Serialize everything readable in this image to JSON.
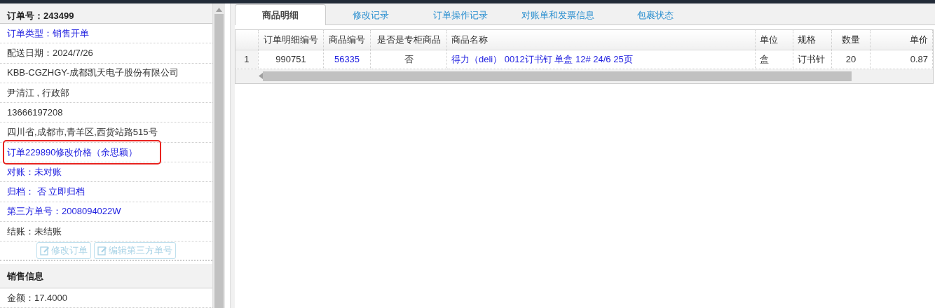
{
  "order_panel": {
    "title": "订单号：243499",
    "rows": [
      {
        "text": "订单类型：销售开单",
        "kind": "link",
        "highlighted": false
      },
      {
        "text": "配送日期：2024/7/26",
        "kind": "plain",
        "highlighted": false
      },
      {
        "text": "KBB-CGZHGY-成都凯天电子股份有限公司",
        "kind": "plain",
        "highlighted": false
      },
      {
        "text": "尹清江 , 行政部",
        "kind": "plain",
        "highlighted": false
      },
      {
        "text": "13666197208",
        "kind": "plain",
        "highlighted": false
      },
      {
        "text": "四川省,成都市,青羊区,西货站路515号",
        "kind": "plain",
        "highlighted": false
      },
      {
        "text": "订单229890修改价格（余思颖）",
        "kind": "link",
        "highlighted": true
      },
      {
        "text": "对账：未对账",
        "kind": "link",
        "highlighted": false
      },
      {
        "text": "归档：  否 立即归档",
        "kind": "link",
        "highlighted": false
      },
      {
        "text": "第三方单号：2008094022W",
        "kind": "link",
        "highlighted": false
      },
      {
        "text": "结账：未结账",
        "kind": "plain",
        "highlighted": false
      }
    ],
    "buttons": [
      {
        "label": "修改订单",
        "disabled": true
      },
      {
        "label": "编辑第三方单号",
        "disabled": true
      }
    ],
    "section_title": "销售信息",
    "section_rows": [
      {
        "text": "金额：17.4000",
        "kind": "plain",
        "highlighted": false
      }
    ]
  },
  "tabs": [
    {
      "label": "商品明细",
      "selected": true
    },
    {
      "label": "修改记录",
      "selected": false
    },
    {
      "label": "订单操作记录",
      "selected": false
    },
    {
      "label": "对账单和发票信息",
      "selected": false
    },
    {
      "label": "包裹状态",
      "selected": false
    }
  ],
  "table": {
    "columns": [
      {
        "label": "订单明细编号"
      },
      {
        "label": "商品编号"
      },
      {
        "label": "是否是专柜商品"
      },
      {
        "label": "商品名称"
      },
      {
        "label": "单位"
      },
      {
        "label": "规格"
      },
      {
        "label": "数量"
      },
      {
        "label": "单价"
      }
    ],
    "rows": [
      {
        "number": "1",
        "cells": [
          {
            "text": "990751",
            "link": false
          },
          {
            "text": "56335",
            "link": true
          },
          {
            "text": "否",
            "link": false
          },
          {
            "text": "得力（deli） 0012订书钉 单盒 12# 24/6 25页",
            "link": true
          },
          {
            "text": "盒",
            "link": false
          },
          {
            "text": "订书针",
            "link": false
          },
          {
            "text": "20",
            "link": false
          },
          {
            "text": "0.87",
            "link": false
          }
        ]
      }
    ]
  }
}
